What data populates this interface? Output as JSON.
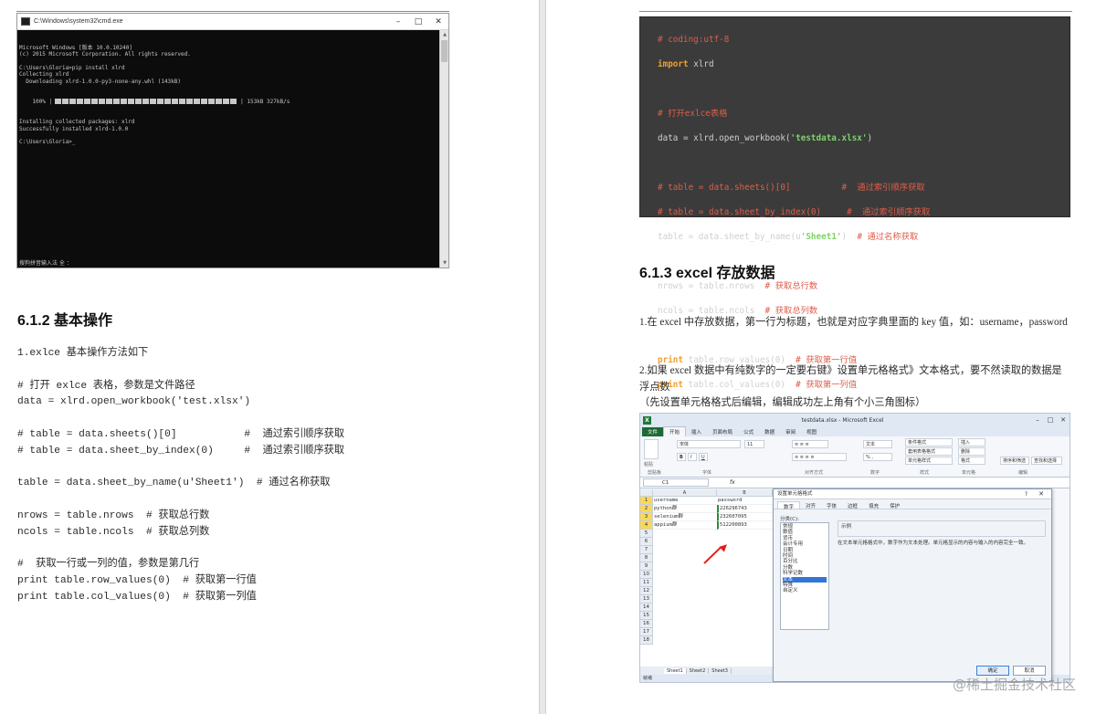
{
  "left": {
    "cmd": {
      "title": "C:\\Windows\\system32\\cmd.exe",
      "lines": [
        "Microsoft Windows [版本 10.0.10240]",
        "(c) 2015 Microsoft Corporation. All rights reserved.",
        "",
        "C:\\Users\\Gloria>pip install xlrd",
        "Collecting xlrd",
        "  Downloading xlrd-1.0.0-py3-none-any.whl (143kB)"
      ],
      "progress_prefix": "    100% |",
      "progress_suffix": "| 153kB 327kB/s",
      "progress_fraction": 1.0,
      "lines_after": [
        "Installing collected packages: xlrd",
        "Successfully installed xlrd-1.0.0",
        "",
        "C:\\Users\\Gloria>_"
      ],
      "status": "搜狗拼音输入法 全 ："
    },
    "heading": "6.1.2  基本操作",
    "body_lines": [
      "1.exlce 基本操作方法如下",
      "",
      "# 打开 exlce 表格，参数是文件路径",
      "data = xlrd.open_workbook('test.xlsx')",
      "",
      "# table = data.sheets()[0]           #  通过索引顺序获取",
      "# table = data.sheet_by_index(0)     #  通过索引顺序获取",
      "",
      "table = data.sheet_by_name(u'Sheet1')  # 通过名称获取",
      "",
      "nrows = table.nrows  # 获取总行数",
      "ncols = table.ncols  # 获取总列数",
      "",
      "#  获取一行或一列的值，参数是第几行",
      "print table.row_values(0)  # 获取第一行值",
      "print table.col_values(0)  # 获取第一列值"
    ]
  },
  "right": {
    "code": {
      "l1": "# coding:utf-8",
      "l2_kw": "import",
      "l2_rest": " xlrd",
      "l3": "# 打开exlce表格",
      "l4_pre": "data = xlrd.open_workbook(",
      "l4_str": "'testdata.xlsx'",
      "l4_post": ")",
      "l5": "# table = data.sheets()[0]          #  通过索引顺序获取",
      "l6": "# table = data.sheet_by_index(0)     #  通过索引顺序获取",
      "l7_pre": "table = data.sheet_by_name(u",
      "l7_str": "'Sheet1'",
      "l7_post": ")  ",
      "l7_com": "# 通过名称获取",
      "l8_pre": "nrows = table.nrows  ",
      "l8_com": "# 获取总行数",
      "l9_pre": "ncols = table.ncols  ",
      "l9_com": "# 获取总列数",
      "l10_kw": "print",
      "l10_pre": " table.row_values(0)  ",
      "l10_com": "# 获取第一行值",
      "l11_kw": "print",
      "l11_pre": " table.col_values(0)  ",
      "l11_com": "# 获取第一列值"
    },
    "heading": "6.1.3 excel 存放数据",
    "para1": "1.在 excel 中存放数据，第一行为标题，也就是对应字典里面的 key 值，如：username，password",
    "para2": "2.如果 excel 数据中有纯数字的一定要右键》设置单元格格式》文本格式，要不然读取的数据是浮点数",
    "para3": "（先设置单元格格式后编辑，编辑成功左上角有个小三角图标）",
    "excel": {
      "title": "testdata.xlsx - Microsoft Excel",
      "tabs": [
        "文件",
        "开始",
        "插入",
        "页面布局",
        "公式",
        "数据",
        "审阅",
        "视图"
      ],
      "font_name": "宋体",
      "font_size": "11",
      "number_format": "文本",
      "groups": [
        "剪贴板",
        "字体",
        "对齐方式",
        "数字",
        "样式",
        "单元格",
        "编辑"
      ],
      "style_btns": [
        "条件格式",
        "套用表格格式",
        "单元格样式"
      ],
      "cell_btns": [
        "插入",
        "删除",
        "格式"
      ],
      "edit_btns": [
        "排序和筛选",
        "查找和选择"
      ],
      "paste_label": "粘贴",
      "name_box": "C1",
      "fx": "fx",
      "col_a": "A",
      "col_b": "B",
      "rows": [
        {
          "a": "username",
          "b": "password"
        },
        {
          "a": "python群",
          "b": "226296743"
        },
        {
          "a": "selenium群",
          "b": "232607095"
        },
        {
          "a": "appium群",
          "b": "512200893"
        }
      ],
      "row_numbers": [
        "1",
        "2",
        "3",
        "4",
        "5",
        "6",
        "7",
        "8",
        "9",
        "10",
        "11",
        "12",
        "13",
        "14",
        "15",
        "16",
        "17",
        "18"
      ],
      "sheets": [
        "Sheet1",
        "Sheet2",
        "Sheet3"
      ],
      "status": "就绪",
      "dialog": {
        "title": "设置单元格格式",
        "help": "?",
        "tabs": [
          "数字",
          "对齐",
          "字体",
          "边框",
          "填充",
          "保护"
        ],
        "list_label": "分类(C):",
        "categories": [
          "常规",
          "数值",
          "货币",
          "会计专用",
          "日期",
          "时间",
          "百分比",
          "分数",
          "科学记数",
          "文本",
          "特殊",
          "自定义"
        ],
        "selected": "文本",
        "sample_label": "示例",
        "description": "在文本单元格格式中，数字作为文本处理。单元格显示的内容与输入的内容完全一致。",
        "ok": "确定",
        "cancel": "取消"
      }
    }
  },
  "watermark": "@稀土掘金技术社区"
}
